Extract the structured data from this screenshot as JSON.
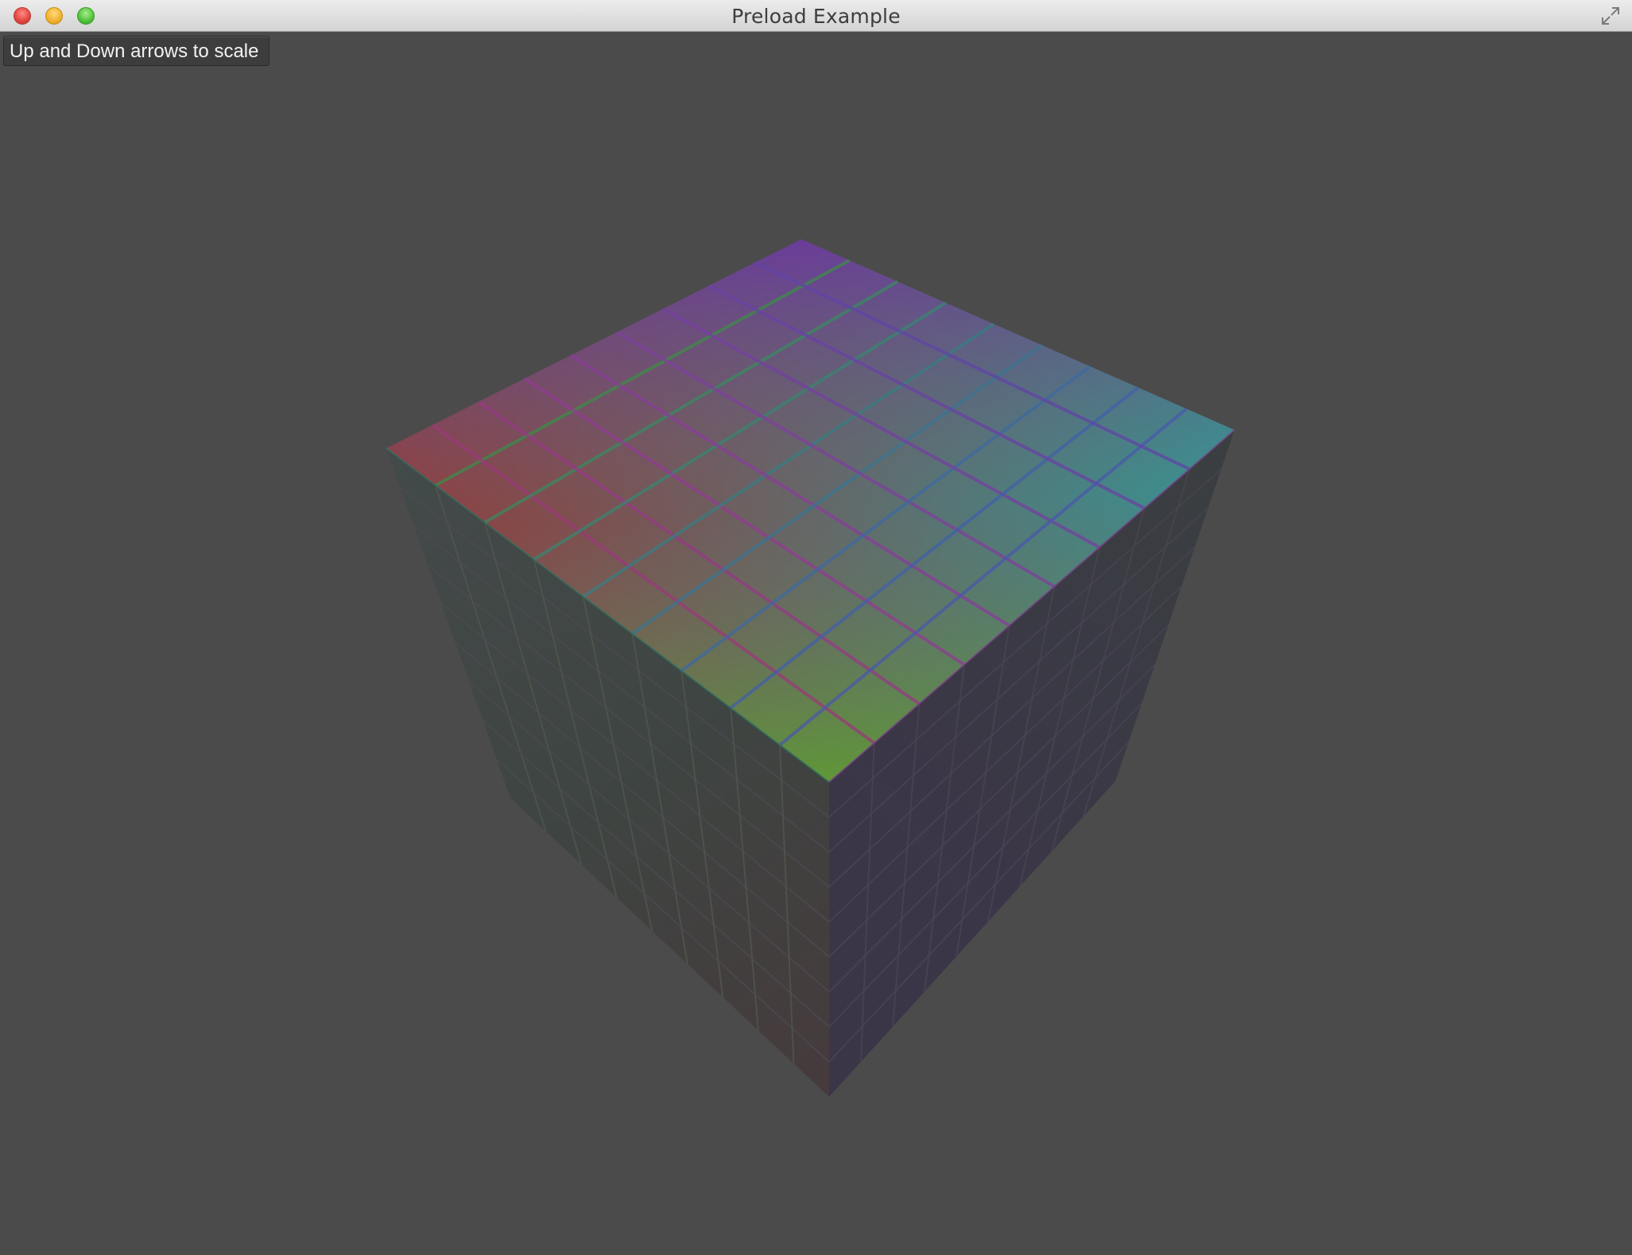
{
  "window": {
    "title": "Preload Example"
  },
  "overlay": {
    "hint": "Up and Down arrows to scale"
  },
  "cube": {
    "grid_divisions": 9,
    "top_face_colors": {
      "left_corner": "#9a3434",
      "back_corner": "#6a3a9c",
      "right_corner": "#2e9a9a",
      "front_corner": "#5f9a34"
    },
    "side_face_color": "#3f3f47",
    "background": "#4b4b4b"
  },
  "icons": {
    "close": "close-traffic-light-icon",
    "minimize": "minimize-traffic-light-icon",
    "zoom": "zoom-traffic-light-icon",
    "fullscreen": "fullscreen-arrows-icon"
  }
}
